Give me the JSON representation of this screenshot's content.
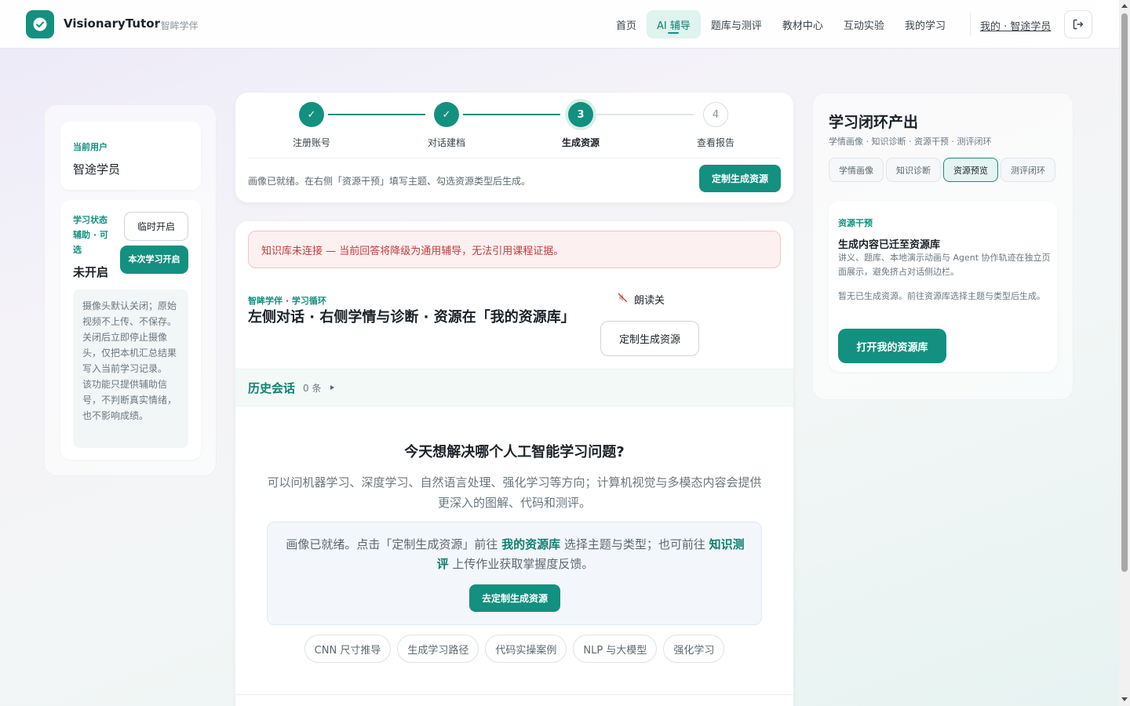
{
  "header": {
    "brand": "VisionaryTutor",
    "brand_sub": "· 智眸学伴",
    "nav": [
      {
        "label": "首页"
      },
      {
        "label": "AI 辅导"
      },
      {
        "label": "题库与测评"
      },
      {
        "label": "教材中心"
      },
      {
        "label": "互动实验"
      },
      {
        "label": "我的学习"
      }
    ],
    "active_nav": "AI 辅导",
    "user_link": "我的 · 智途学员"
  },
  "left": {
    "user_label": "当前用户",
    "user_name": "智途学员",
    "assist_title": "学习状态辅助 · 可选",
    "assist_state": "未开启",
    "btn_temp": "临时开启",
    "btn_session": "本次学习开启",
    "note": "摄像头默认关闭；原始视频不上传、不保存。关闭后立即停止摄像头，仅把本机汇总结果写入当前学习记录。 该功能只提供辅助信号，不判断真实情绪，也不影响成绩。"
  },
  "stepper": {
    "steps": [
      {
        "num": "✓",
        "label": "注册账号",
        "state": "done"
      },
      {
        "num": "✓",
        "label": "对话建档",
        "state": "done"
      },
      {
        "num": "3",
        "label": "生成资源",
        "state": "current"
      },
      {
        "num": "4",
        "label": "查看报告",
        "state": "todo"
      }
    ],
    "message": "画像已就绪。在右侧「资源干预」填写主题、勾选资源类型后生成。",
    "button": "定制生成资源"
  },
  "chat": {
    "alert": "知识库未连接 — 当前回答将降级为通用辅导，无法引用课程证据。",
    "tag": "智眸学伴 · 学习循环",
    "title": "左侧对话 · 右侧学情与诊断 · 资源在「我的资源库」",
    "read_toggle": "朗读关",
    "custom_button": "定制生成资源",
    "history_title": "历史会话",
    "history_count": "0 条",
    "welcome_title": "今天想解决哪个人工智能学习问题?",
    "welcome_sub": "可以问机器学习、深度学习、自然语言处理、强化学习等方向；计算机视觉与多模态内容会提供更深入的图解、代码和测评。",
    "info": {
      "part1": "画像已就绪。点击「定制生成资源」前往 ",
      "link1": "我的资源库",
      "part2": " 选择主题与类型；也可前往 ",
      "link2": "知识测评",
      "part3": " 上传作业获取掌握度反馈。",
      "button": "去定制生成资源"
    },
    "chips": [
      "CNN 尺寸推导",
      "生成学习路径",
      "代码实操案例",
      "NLP 与大模型",
      "强化学习"
    ]
  },
  "right": {
    "title": "学习闭环产出",
    "subtitle": "学情画像 · 知识诊断 · 资源干预 · 测评闭环",
    "tabs": [
      "学情画像",
      "知识诊断",
      "资源预览",
      "测评闭环"
    ],
    "active_tab": "资源预览",
    "card": {
      "label": "资源干预",
      "title": "生成内容已迁至资源库",
      "desc": "讲义、题库、本地演示动画与 Agent 协作轨迹在独立页面展示，避免挤占对话侧边栏。",
      "empty": "暂无已生成资源。前往资源库选择主题与类型后生成。",
      "button": "打开我的资源库"
    }
  },
  "colors": {
    "accent": "#13907f",
    "alert_bg": "#fdf0f0",
    "alert_text": "#c23c3c"
  },
  "icons": {
    "logo": "check-circle-icon",
    "logout": "logout-icon",
    "read": "speaker-muted-icon"
  }
}
